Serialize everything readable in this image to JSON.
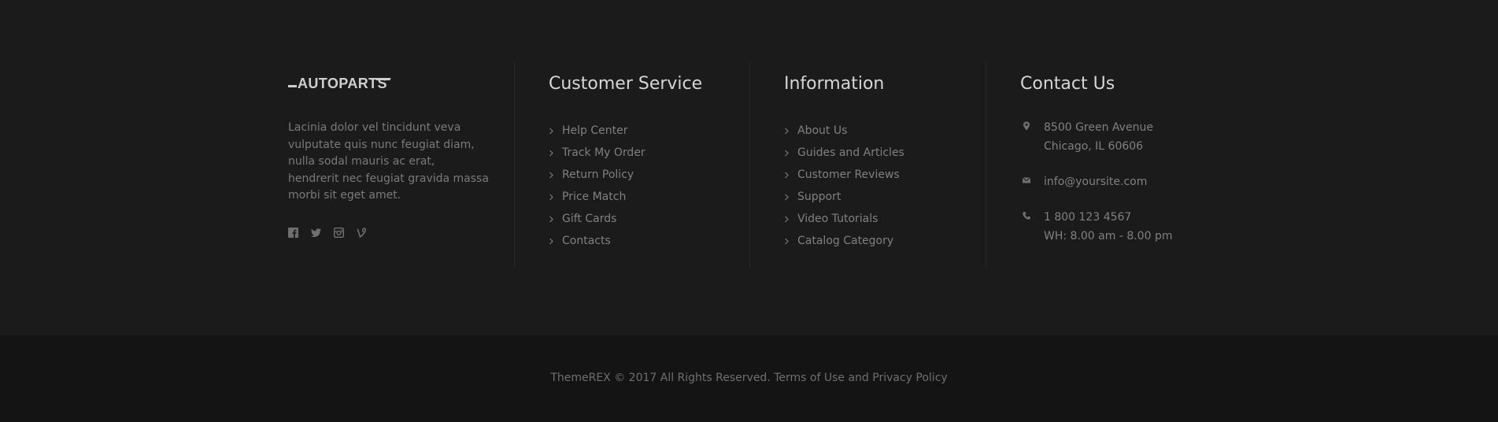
{
  "brand": {
    "logo_text": "AUTOPARTS"
  },
  "about": {
    "text": "Lacinia dolor vel tincidunt veva vulputate quis nunc feugiat diam, nulla sodal mauris ac erat, hendrerit nec feugiat gravida massa morbi sit eget amet.",
    "social": [
      {
        "icon": "facebook-icon"
      },
      {
        "icon": "twitter-icon"
      },
      {
        "icon": "instagram-icon"
      },
      {
        "icon": "vine-icon"
      }
    ]
  },
  "customer_service": {
    "title": "Customer Service",
    "items": [
      "Help Center",
      "Track My Order",
      "Return Policy",
      "Price Match",
      "Gift Cards",
      "Contacts"
    ]
  },
  "information": {
    "title": "Information",
    "items": [
      "About Us",
      "Guides and Articles",
      "Customer Reviews",
      "Support",
      "Video Tutorials",
      "Catalog Category"
    ]
  },
  "contact": {
    "title": "Contact Us",
    "address_line1": "8500 Green Avenue",
    "address_line2": "Chicago, IL 60606",
    "email": "info@yoursite.com",
    "phone": "1 800 123 4567",
    "hours": "WH: 8.00 am - 8.00 pm"
  },
  "footer": {
    "copyright": "ThemeREX © 2017 All Rights Reserved.",
    "terms_label": "Terms of Use",
    "and_text": "and",
    "privacy_label": "Privacy Policy"
  },
  "colors": {
    "background": "#1b1b1b",
    "bottom_bar": "#141414",
    "heading": "#d6d6d6",
    "text": "#808080"
  }
}
